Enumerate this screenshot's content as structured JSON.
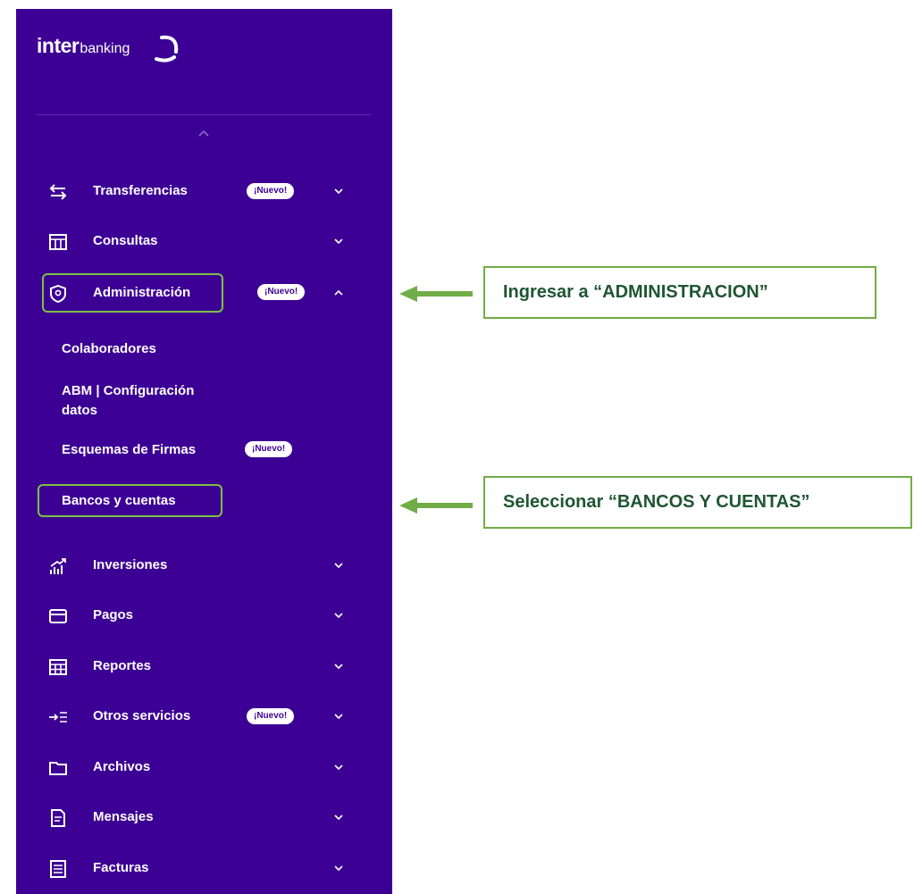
{
  "brand": {
    "bold": "inter",
    "light": "banking"
  },
  "menu": {
    "transferencias": {
      "label": "Transferencias",
      "badge": "¡Nuevo!"
    },
    "consultas": {
      "label": "Consultas"
    },
    "administracion": {
      "label": "Administración",
      "badge": "¡Nuevo!"
    },
    "submenu": {
      "colaboradores": "Colaboradores",
      "abm_line1": "ABM | Configuración",
      "abm_line2": "datos",
      "esquemas": "Esquemas de Firmas",
      "esquemas_badge": "¡Nuevo!",
      "bancos": "Bancos y cuentas"
    },
    "inversiones": {
      "label": "Inversiones"
    },
    "pagos": {
      "label": "Pagos"
    },
    "reportes": {
      "label": "Reportes"
    },
    "otros": {
      "label": "Otros servicios",
      "badge": "¡Nuevo!"
    },
    "archivos": {
      "label": "Archivos"
    },
    "mensajes": {
      "label": "Mensajes"
    },
    "facturas": {
      "label": "Facturas"
    }
  },
  "callouts": {
    "administracion": "Ingresar a “ADMINISTRACION”",
    "bancos": "Seleccionar “BANCOS Y CUENTAS”"
  },
  "colors": {
    "sidebar": "#3c0094",
    "highlight": "#7dc242",
    "callout_text": "#1e5631",
    "arrow": "#70ad47"
  }
}
